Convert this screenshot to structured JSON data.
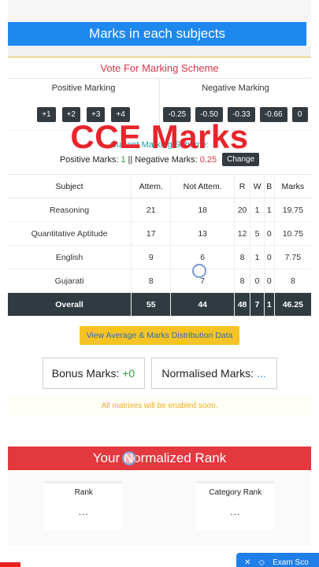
{
  "banner": {
    "title": "Marks in each subjects"
  },
  "vote": {
    "title": "Vote For Marking Scheme"
  },
  "marking": {
    "positive_label": "Positive Marking",
    "negative_label": "Negative Marking",
    "positive_options": [
      "+1",
      "+2",
      "+3",
      "+4"
    ],
    "negative_options": [
      "-0.25",
      "-0.50",
      "-0.33",
      "-0.66",
      "0"
    ]
  },
  "overlay": {
    "text": "CCE Marks"
  },
  "scheme": {
    "title": "Current Marking Scheme:",
    "positive_prefix": "Positive Marks:",
    "positive_value": "1",
    "separator": "||",
    "negative_prefix": "Negative Marks:",
    "negative_value": "0.25",
    "change_label": "Change"
  },
  "table": {
    "headers": [
      "Subject",
      "Attem.",
      "Not Attem.",
      "R",
      "W",
      "B",
      "Marks"
    ],
    "rows": [
      [
        "Reasoning",
        "21",
        "18",
        "20",
        "1",
        "1",
        "19.75"
      ],
      [
        "Quantitative Aptitude",
        "17",
        "13",
        "12",
        "5",
        "0",
        "10.75"
      ],
      [
        "English",
        "9",
        "6",
        "8",
        "1",
        "0",
        "7.75"
      ],
      [
        "Gujarati",
        "8",
        "7",
        "8",
        "0",
        "0",
        "8"
      ]
    ],
    "overall": [
      "Overall",
      "55",
      "44",
      "48",
      "7",
      "1",
      "46.25"
    ]
  },
  "actions": {
    "avg_label": "View Average & Marks Distribution Data"
  },
  "cards": {
    "bonus_label": "Bonus Marks:",
    "bonus_value": "+0",
    "normalised_label": "Normalised Marks:",
    "normalised_value": "..."
  },
  "note": {
    "text": "All matrixes will be enabled soon."
  },
  "rank": {
    "title": "Your Normalized Rank",
    "rank_label": "Rank",
    "rank_value": "...",
    "category_label": "Category Rank",
    "category_value": "..."
  },
  "bottom": {
    "close": "✕",
    "label": "Exam Sco"
  },
  "colors": {
    "blue": "#1e88ef",
    "red": "#e4383f",
    "dark": "#2f3a41",
    "yellow": "#f6c324"
  }
}
